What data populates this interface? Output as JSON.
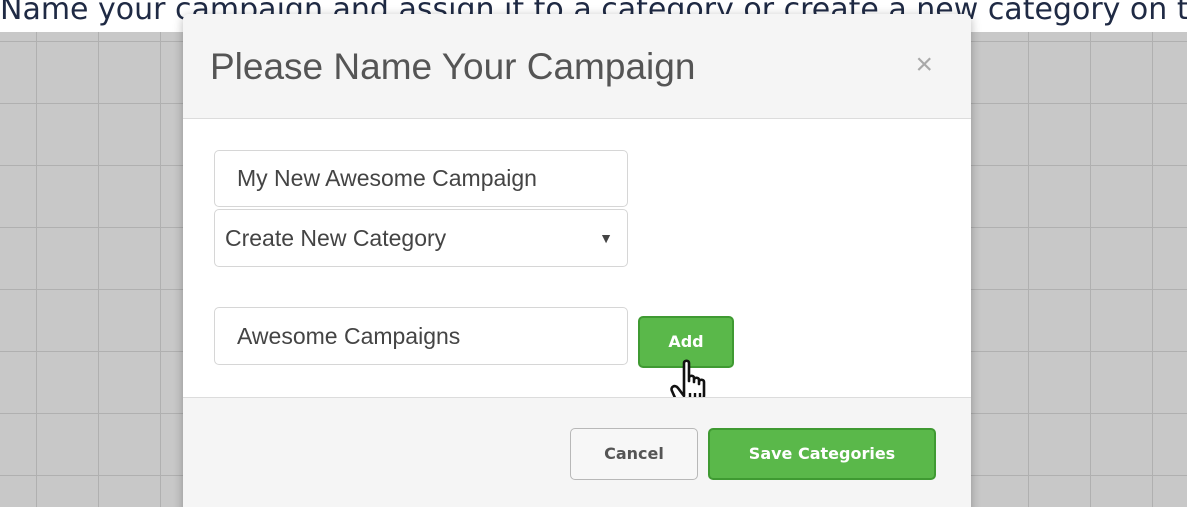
{
  "caption": "Name your campaign and assign it to a category or create a new category on the fly",
  "modal": {
    "title": "Please Name Your Campaign",
    "close_symbol": "×",
    "campaign_name_value": "My New Awesome Campaign",
    "category_select_value": "Create New Category",
    "select_caret": "▼",
    "new_category_value": "Awesome Campaigns",
    "add_label": "Add",
    "cancel_label": "Cancel",
    "save_label": "Save Categories"
  },
  "colors": {
    "primary_green": "#5ab84a",
    "primary_green_border": "#3f9a32",
    "header_bg": "#f5f5f5",
    "backdrop_grid": "#c8c8c8"
  },
  "icons": {
    "close": "close-icon",
    "caret": "chevron-down-icon",
    "cursor": "hand-pointer-icon"
  }
}
